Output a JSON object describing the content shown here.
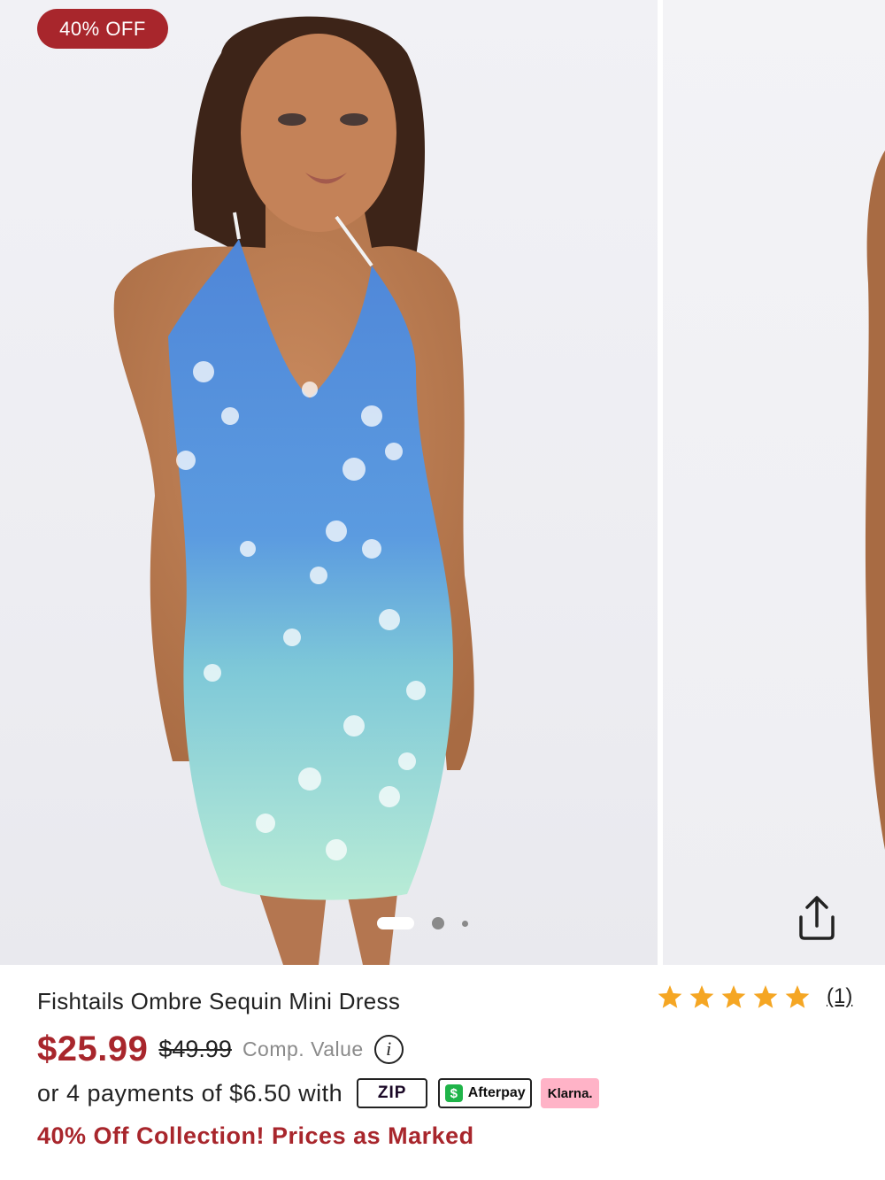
{
  "product": {
    "badge": "40% OFF",
    "title": "Fishtails Ombre Sequin Mini Dress",
    "rating_count": "(1)",
    "rating_stars": 5,
    "sale_price": "$25.99",
    "original_price": "$49.99",
    "comp_value_label": "Comp. Value",
    "info_symbol": "i"
  },
  "payments": {
    "installment_text": "or 4 payments of $6.50 with",
    "zip_label": "ZIP",
    "afterpay_label": "Afterpay",
    "afterpay_symbol": "$",
    "klarna_label": "Klarna."
  },
  "promo": {
    "text": "40% Off Collection! Prices as Marked"
  },
  "carousel": {
    "image_count": 3,
    "active_index": 0
  },
  "colors": {
    "accent": "#a8262c",
    "star": "#f5a623",
    "klarna": "#ffb3c7",
    "afterpay": "#1fb449"
  },
  "icons": {
    "share": "share-icon",
    "info": "info-icon",
    "star": "star-icon"
  }
}
